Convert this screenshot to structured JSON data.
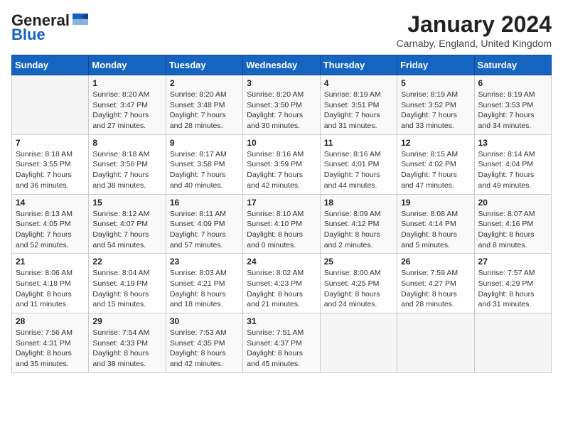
{
  "logo": {
    "general": "General",
    "blue": "Blue"
  },
  "header": {
    "title": "January 2024",
    "subtitle": "Carnaby, England, United Kingdom"
  },
  "weekdays": [
    "Sunday",
    "Monday",
    "Tuesday",
    "Wednesday",
    "Thursday",
    "Friday",
    "Saturday"
  ],
  "weeks": [
    [
      {
        "day": "",
        "info": ""
      },
      {
        "day": "1",
        "info": "Sunrise: 8:20 AM\nSunset: 3:47 PM\nDaylight: 7 hours\nand 27 minutes."
      },
      {
        "day": "2",
        "info": "Sunrise: 8:20 AM\nSunset: 3:48 PM\nDaylight: 7 hours\nand 28 minutes."
      },
      {
        "day": "3",
        "info": "Sunrise: 8:20 AM\nSunset: 3:50 PM\nDaylight: 7 hours\nand 30 minutes."
      },
      {
        "day": "4",
        "info": "Sunrise: 8:19 AM\nSunset: 3:51 PM\nDaylight: 7 hours\nand 31 minutes."
      },
      {
        "day": "5",
        "info": "Sunrise: 8:19 AM\nSunset: 3:52 PM\nDaylight: 7 hours\nand 33 minutes."
      },
      {
        "day": "6",
        "info": "Sunrise: 8:19 AM\nSunset: 3:53 PM\nDaylight: 7 hours\nand 34 minutes."
      }
    ],
    [
      {
        "day": "7",
        "info": "Sunrise: 8:18 AM\nSunset: 3:55 PM\nDaylight: 7 hours\nand 36 minutes."
      },
      {
        "day": "8",
        "info": "Sunrise: 8:18 AM\nSunset: 3:56 PM\nDaylight: 7 hours\nand 38 minutes."
      },
      {
        "day": "9",
        "info": "Sunrise: 8:17 AM\nSunset: 3:58 PM\nDaylight: 7 hours\nand 40 minutes."
      },
      {
        "day": "10",
        "info": "Sunrise: 8:16 AM\nSunset: 3:59 PM\nDaylight: 7 hours\nand 42 minutes."
      },
      {
        "day": "11",
        "info": "Sunrise: 8:16 AM\nSunset: 4:01 PM\nDaylight: 7 hours\nand 44 minutes."
      },
      {
        "day": "12",
        "info": "Sunrise: 8:15 AM\nSunset: 4:02 PM\nDaylight: 7 hours\nand 47 minutes."
      },
      {
        "day": "13",
        "info": "Sunrise: 8:14 AM\nSunset: 4:04 PM\nDaylight: 7 hours\nand 49 minutes."
      }
    ],
    [
      {
        "day": "14",
        "info": "Sunrise: 8:13 AM\nSunset: 4:05 PM\nDaylight: 7 hours\nand 52 minutes."
      },
      {
        "day": "15",
        "info": "Sunrise: 8:12 AM\nSunset: 4:07 PM\nDaylight: 7 hours\nand 54 minutes."
      },
      {
        "day": "16",
        "info": "Sunrise: 8:11 AM\nSunset: 4:09 PM\nDaylight: 7 hours\nand 57 minutes."
      },
      {
        "day": "17",
        "info": "Sunrise: 8:10 AM\nSunset: 4:10 PM\nDaylight: 8 hours\nand 0 minutes."
      },
      {
        "day": "18",
        "info": "Sunrise: 8:09 AM\nSunset: 4:12 PM\nDaylight: 8 hours\nand 2 minutes."
      },
      {
        "day": "19",
        "info": "Sunrise: 8:08 AM\nSunset: 4:14 PM\nDaylight: 8 hours\nand 5 minutes."
      },
      {
        "day": "20",
        "info": "Sunrise: 8:07 AM\nSunset: 4:16 PM\nDaylight: 8 hours\nand 8 minutes."
      }
    ],
    [
      {
        "day": "21",
        "info": "Sunrise: 8:06 AM\nSunset: 4:18 PM\nDaylight: 8 hours\nand 11 minutes."
      },
      {
        "day": "22",
        "info": "Sunrise: 8:04 AM\nSunset: 4:19 PM\nDaylight: 8 hours\nand 15 minutes."
      },
      {
        "day": "23",
        "info": "Sunrise: 8:03 AM\nSunset: 4:21 PM\nDaylight: 8 hours\nand 18 minutes."
      },
      {
        "day": "24",
        "info": "Sunrise: 8:02 AM\nSunset: 4:23 PM\nDaylight: 8 hours\nand 21 minutes."
      },
      {
        "day": "25",
        "info": "Sunrise: 8:00 AM\nSunset: 4:25 PM\nDaylight: 8 hours\nand 24 minutes."
      },
      {
        "day": "26",
        "info": "Sunrise: 7:59 AM\nSunset: 4:27 PM\nDaylight: 8 hours\nand 28 minutes."
      },
      {
        "day": "27",
        "info": "Sunrise: 7:57 AM\nSunset: 4:29 PM\nDaylight: 8 hours\nand 31 minutes."
      }
    ],
    [
      {
        "day": "28",
        "info": "Sunrise: 7:56 AM\nSunset: 4:31 PM\nDaylight: 8 hours\nand 35 minutes."
      },
      {
        "day": "29",
        "info": "Sunrise: 7:54 AM\nSunset: 4:33 PM\nDaylight: 8 hours\nand 38 minutes."
      },
      {
        "day": "30",
        "info": "Sunrise: 7:53 AM\nSunset: 4:35 PM\nDaylight: 8 hours\nand 42 minutes."
      },
      {
        "day": "31",
        "info": "Sunrise: 7:51 AM\nSunset: 4:37 PM\nDaylight: 8 hours\nand 45 minutes."
      },
      {
        "day": "",
        "info": ""
      },
      {
        "day": "",
        "info": ""
      },
      {
        "day": "",
        "info": ""
      }
    ]
  ]
}
